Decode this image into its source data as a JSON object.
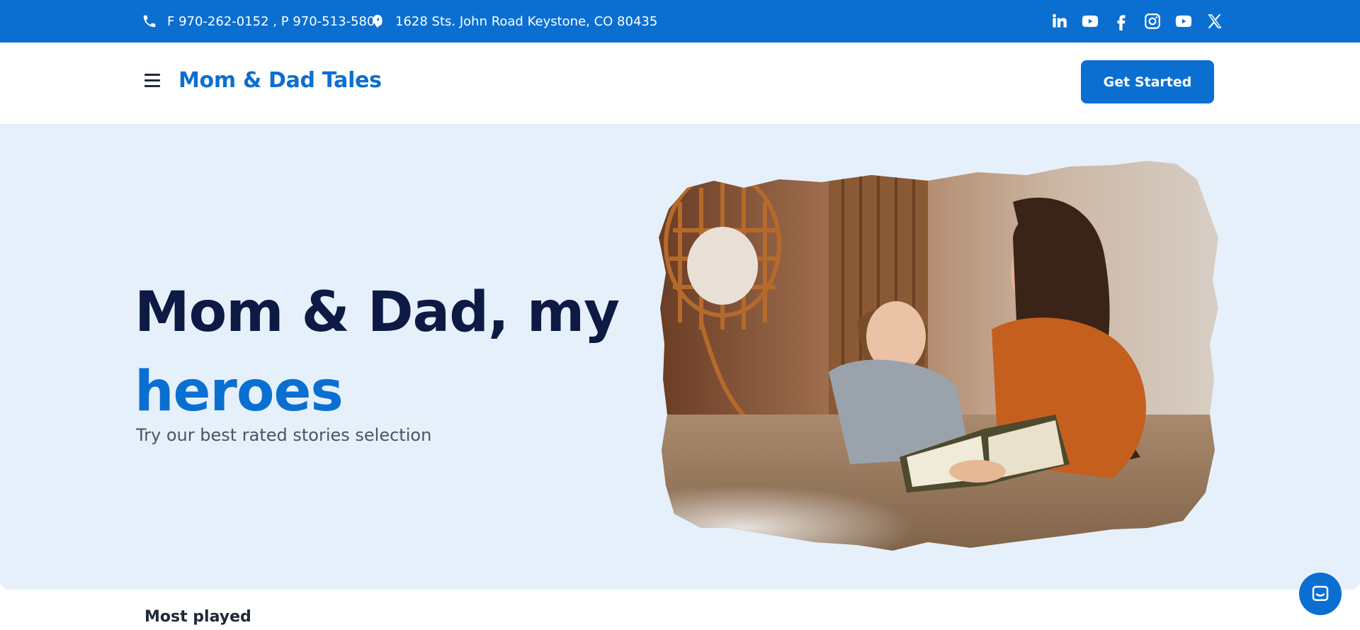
{
  "topbar": {
    "phone_text": "F 970-262-0152 , P 970-513-5800",
    "address_text": "1628 Sts. John Road Keystone, CO 80435",
    "phone_icon": "phone-icon",
    "address_icon": "location-pin-icon",
    "socials": [
      "linkedin-icon",
      "youtube-icon",
      "facebook-icon",
      "instagram-icon",
      "youtube-icon",
      "x-icon"
    ]
  },
  "header": {
    "brand": "Mom & Dad Tales",
    "cta_label": "Get Started",
    "menu_icon": "hamburger-icon"
  },
  "hero": {
    "title_line1": "Mom & Dad, my",
    "title_line2": "heroes",
    "subtitle": "Try our best rated stories selection",
    "image_alt": "mother-and-daughter-reading-image"
  },
  "section": {
    "most_played": "Most played"
  },
  "colors": {
    "brand_blue": "#0b6fd1",
    "hero_bg": "#e6f0fb",
    "title_dark": "#0c1a44"
  }
}
